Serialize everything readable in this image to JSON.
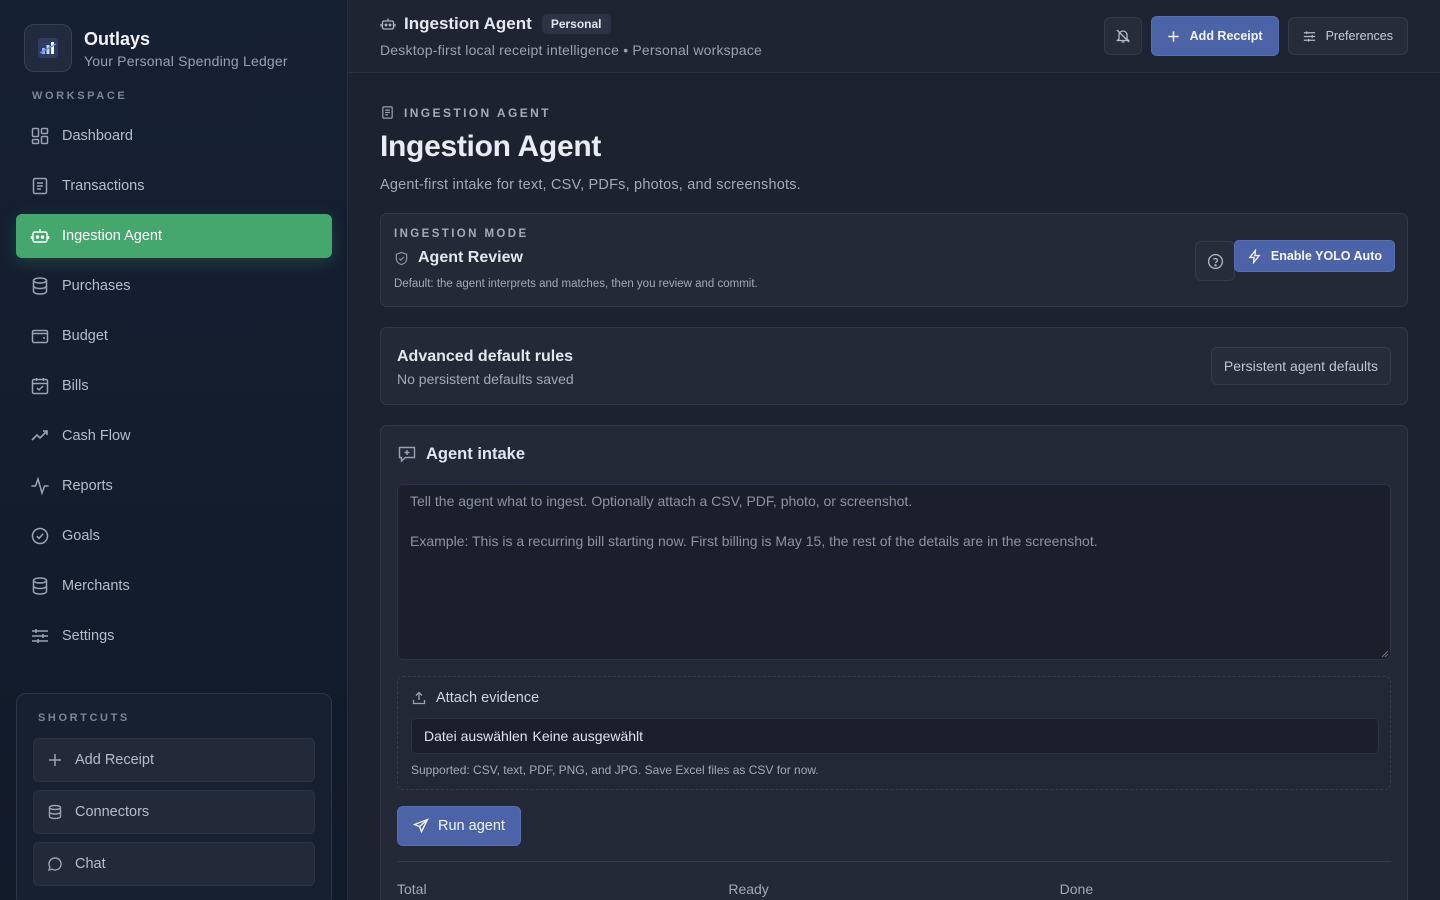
{
  "brand": {
    "name": "Outlays",
    "subtitle": "Your Personal Spending Ledger"
  },
  "sidebar": {
    "section_label": "WORKSPACE",
    "items": [
      {
        "label": "Dashboard",
        "icon": "dashboard-icon"
      },
      {
        "label": "Transactions",
        "icon": "document-icon"
      },
      {
        "label": "Ingestion Agent",
        "icon": "robot-icon",
        "active": true
      },
      {
        "label": "Purchases",
        "icon": "database-icon"
      },
      {
        "label": "Budget",
        "icon": "wallet-icon"
      },
      {
        "label": "Bills",
        "icon": "calendar-icon"
      },
      {
        "label": "Cash Flow",
        "icon": "trending-up-icon"
      },
      {
        "label": "Reports",
        "icon": "activity-icon"
      },
      {
        "label": "Goals",
        "icon": "check-circle-icon"
      },
      {
        "label": "Merchants",
        "icon": "database-icon"
      },
      {
        "label": "Settings",
        "icon": "sliders-icon"
      }
    ],
    "shortcuts_label": "SHORTCUTS",
    "shortcuts": [
      {
        "label": "Add Receipt",
        "icon": "plus-icon"
      },
      {
        "label": "Connectors",
        "icon": "database-icon"
      },
      {
        "label": "Chat",
        "icon": "chat-icon"
      }
    ]
  },
  "topbar": {
    "title": "Ingestion Agent",
    "badge": "Personal",
    "subtitle": "Desktop-first local receipt intelligence • Personal workspace",
    "add_receipt": "Add Receipt",
    "preferences": "Preferences"
  },
  "page": {
    "kicker": "INGESTION AGENT",
    "title": "Ingestion Agent",
    "description": "Agent-first intake for text, CSV, PDFs, photos, and screenshots."
  },
  "mode": {
    "label": "INGESTION MODE",
    "name": "Agent Review",
    "hint": "Default: the agent interprets and matches, then you review and commit.",
    "yolo_button": "Enable YOLO Auto"
  },
  "rules": {
    "title": "Advanced default rules",
    "status": "No persistent defaults saved",
    "button": "Persistent agent defaults"
  },
  "intake": {
    "title": "Agent intake",
    "placeholder": "Tell the agent what to ingest. Optionally attach a CSV, PDF, photo, or screenshot.\n\nExample: This is a recurring bill starting now. First billing is May 15, the rest of the details are in the screenshot.",
    "attach_title": "Attach evidence",
    "file_button": "Datei auswählen",
    "file_status": "Keine ausgewählt",
    "supported_note": "Supported: CSV, text, PDF, PNG, and JPG. Save Excel files as CSV for now.",
    "run_button": "Run agent",
    "stats": [
      "Total",
      "Ready",
      "Done"
    ]
  },
  "colors": {
    "accent_green": "#46a76e",
    "primary_blue": "#4d63a8",
    "background": "#1d2230",
    "sidebar": "#131c2c"
  }
}
